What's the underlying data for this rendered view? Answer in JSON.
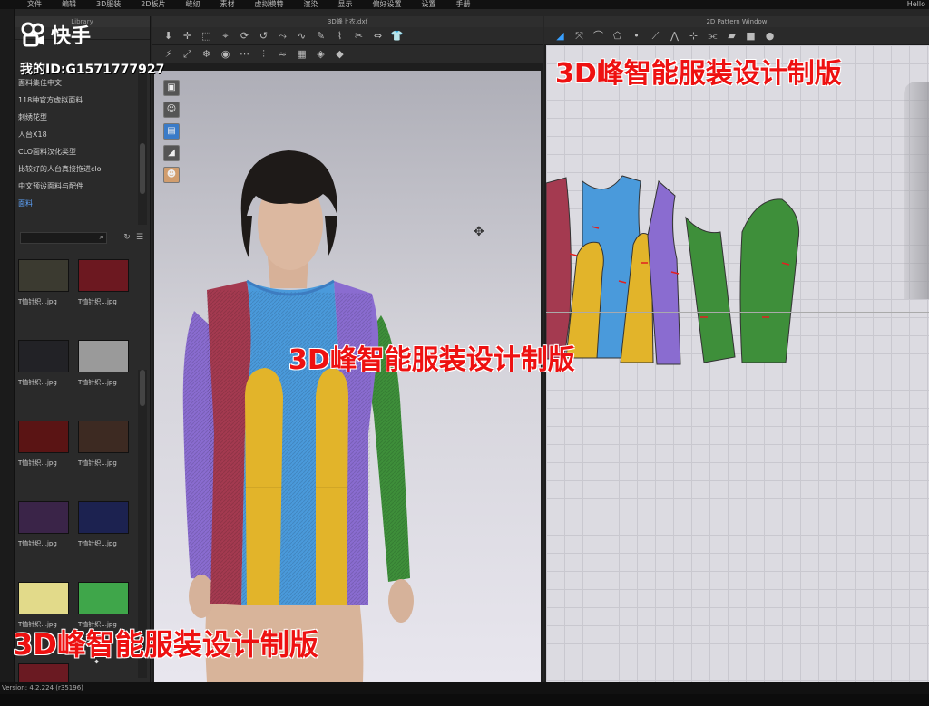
{
  "menu": {
    "items": [
      "文件",
      "编辑",
      "3D服装",
      "2D板片",
      "缝纫",
      "素材",
      "虚拟模特",
      "渲染",
      "显示",
      "偏好设置",
      "设置",
      "手册"
    ],
    "hello": "Hello"
  },
  "library": {
    "title": "Library",
    "items": [
      "面料集佳中文",
      "118种官方虚拟面料",
      "刺绣花型",
      "人台X18",
      "CLO面料汉化类型",
      "比较好的人台真接拖进clo",
      "中文预设面料与配件",
      "面料"
    ],
    "fabrics": [
      {
        "label": "T恤针织...jpg",
        "color": "#3b3a30"
      },
      {
        "label": "T恤针织...jpg",
        "color": "#6c1820"
      },
      {
        "label": "T恤针织...jpg",
        "color": "#222226"
      },
      {
        "label": "T恤针织...jpg",
        "color": "#9a9a9a"
      },
      {
        "label": "T恤针织...jpg",
        "color": "#5a1414"
      },
      {
        "label": "T恤针织...jpg",
        "color": "#3d2a22"
      },
      {
        "label": "T恤针织...jpg",
        "color": "#3a2448"
      },
      {
        "label": "T恤针织...jpg",
        "color": "#1c2250"
      },
      {
        "label": "T恤针织...jpg",
        "color": "#e2da8a"
      },
      {
        "label": "T恤针织...jpg",
        "color": "#3fa64a"
      }
    ]
  },
  "window3d": {
    "title": "3D峰上衣.dxf"
  },
  "window2d": {
    "title": "2D Pattern Window"
  },
  "status": {
    "version": "Version: 4.2.224 (r35196)"
  },
  "overlay": {
    "app_name": "快手",
    "user_id": "我的ID:G1571777927",
    "watermark": "3D峰智能服装设计制版"
  }
}
